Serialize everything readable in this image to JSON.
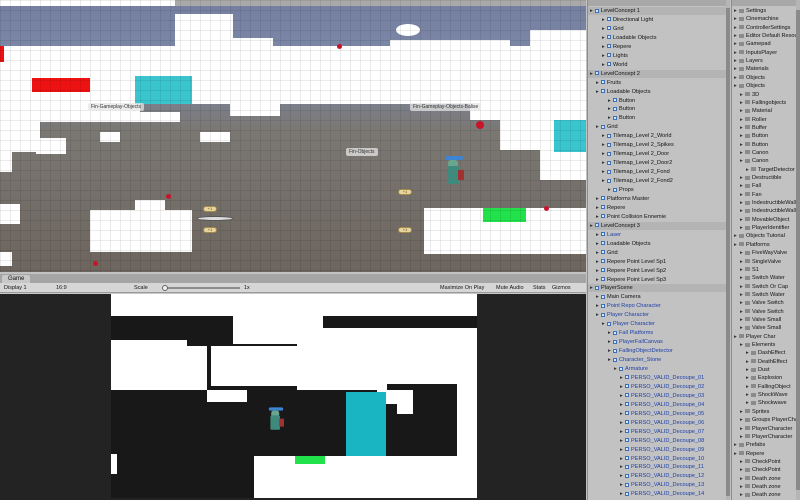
{
  "scene": {
    "labels": {
      "a": "Fin-Gameplay-Objects",
      "b": "Fin-Gameplay-Objects-Balise",
      "c": "Fin-Objects"
    },
    "coins": [
      "+1",
      "+1",
      "+1",
      "+1"
    ]
  },
  "game": {
    "tab": "Game",
    "display": "Display 1",
    "aspect": "16:9",
    "scale_label": "Scale",
    "scale_value": "1x",
    "maximize": "Maximize On Play",
    "mute": "Mute Audio",
    "stats": "Stats",
    "gizmos": "Gizmos"
  },
  "hierarchy": {
    "rows": [
      {
        "t": "LevelConcept 1",
        "i": 0,
        "k": "scene"
      },
      {
        "t": "Directional Light",
        "i": 2
      },
      {
        "t": "Grid",
        "i": 2
      },
      {
        "t": "Loadable Objects",
        "i": 2
      },
      {
        "t": "Repere",
        "i": 2
      },
      {
        "t": "Lights",
        "i": 2
      },
      {
        "t": "World",
        "i": 2
      },
      {
        "t": "LevelConcept 2",
        "i": 0,
        "k": "scene"
      },
      {
        "t": "Fruits",
        "i": 1
      },
      {
        "t": "Loadable Objects",
        "i": 1
      },
      {
        "t": "Button",
        "i": 3
      },
      {
        "t": "Button",
        "i": 3
      },
      {
        "t": "Button",
        "i": 3
      },
      {
        "t": "Grid",
        "i": 1
      },
      {
        "t": "Tilemap_Level 2_World",
        "i": 2
      },
      {
        "t": "Tilemap_Level 2_Spikes",
        "i": 2
      },
      {
        "t": "Tilemap_Level 2_Door",
        "i": 2
      },
      {
        "t": "Tilemap_Level 2_Door2",
        "i": 2
      },
      {
        "t": "Tilemap_Level 2_Fond",
        "i": 2
      },
      {
        "t": "Tilemap_Level 2_Fond2",
        "i": 2
      },
      {
        "t": "Props",
        "i": 3
      },
      {
        "t": "Platforms Master",
        "i": 1
      },
      {
        "t": "Repere",
        "i": 1
      },
      {
        "t": "Point Collision Ennemie",
        "i": 1
      },
      {
        "t": "LevelConcept 3",
        "i": 0,
        "k": "scene"
      },
      {
        "t": "Laser",
        "i": 1,
        "k": "blue"
      },
      {
        "t": "Loadable Objects",
        "i": 1
      },
      {
        "t": "Grid",
        "i": 1
      },
      {
        "t": "Repere Point Level Sp1",
        "i": 1
      },
      {
        "t": "Repere Point Level Sp2",
        "i": 1
      },
      {
        "t": "Repere Point Level Sp3",
        "i": 1
      },
      {
        "t": "PlayerScene",
        "i": 0,
        "k": "scene"
      },
      {
        "t": "Main Camera",
        "i": 1
      },
      {
        "t": "Point Repo Character",
        "i": 1,
        "k": "blue"
      },
      {
        "t": "Player Character",
        "i": 1,
        "k": "blue"
      },
      {
        "t": "Player Character",
        "i": 2,
        "k": "blue"
      },
      {
        "t": "Fall Platforms",
        "i": 3,
        "k": "blue"
      },
      {
        "t": "PlayerFallCanvas",
        "i": 3,
        "k": "blue"
      },
      {
        "t": "FallingObjectDetector",
        "i": 3,
        "k": "blue"
      },
      {
        "t": "Character_Stone",
        "i": 3,
        "k": "blue"
      },
      {
        "t": "Armature",
        "i": 4,
        "k": "blue"
      },
      {
        "t": "PERSO_VALID_Decoupe_01",
        "i": 5,
        "k": "blue"
      },
      {
        "t": "PERSO_VALID_Decoupe_02",
        "i": 5,
        "k": "blue"
      },
      {
        "t": "PERSO_VALID_Decoupe_03",
        "i": 5,
        "k": "blue"
      },
      {
        "t": "PERSO_VALID_Decoupe_04",
        "i": 5,
        "k": "blue"
      },
      {
        "t": "PERSO_VALID_Decoupe_05",
        "i": 5,
        "k": "blue"
      },
      {
        "t": "PERSO_VALID_Decoupe_06",
        "i": 5,
        "k": "blue"
      },
      {
        "t": "PERSO_VALID_Decoupe_07",
        "i": 5,
        "k": "blue"
      },
      {
        "t": "PERSO_VALID_Decoupe_08",
        "i": 5,
        "k": "blue"
      },
      {
        "t": "PERSO_VALID_Decoupe_09",
        "i": 5,
        "k": "blue"
      },
      {
        "t": "PERSO_VALID_Decoupe_10",
        "i": 5,
        "k": "blue"
      },
      {
        "t": "PERSO_VALID_Decoupe_11",
        "i": 5,
        "k": "blue"
      },
      {
        "t": "PERSO_VALID_Decoupe_12",
        "i": 5,
        "k": "blue"
      },
      {
        "t": "PERSO_VALID_Decoupe_13",
        "i": 5,
        "k": "blue"
      },
      {
        "t": "PERSO_VALID_Decoupe_14",
        "i": 5,
        "k": "blue"
      }
    ]
  },
  "project": {
    "rows": [
      {
        "t": "Settings",
        "i": 0
      },
      {
        "t": "Cinemachine",
        "i": 0
      },
      {
        "t": "ControllerSettings",
        "i": 0
      },
      {
        "t": "Editor Default Resources",
        "i": 0
      },
      {
        "t": "Gamepad",
        "i": 0
      },
      {
        "t": "InputsPlayer",
        "i": 0
      },
      {
        "t": "Layers",
        "i": 0
      },
      {
        "t": "Materials",
        "i": 0
      },
      {
        "t": "Objects",
        "i": 0
      },
      {
        "t": "Objects",
        "i": 0
      },
      {
        "t": "3D",
        "i": 1
      },
      {
        "t": "Fallingobjects",
        "i": 1
      },
      {
        "t": "Material",
        "i": 1
      },
      {
        "t": "Roller",
        "i": 1
      },
      {
        "t": "Buffer",
        "i": 1
      },
      {
        "t": "Button",
        "i": 1
      },
      {
        "t": "Button",
        "i": 1
      },
      {
        "t": "Canon",
        "i": 1
      },
      {
        "t": "Canon",
        "i": 1
      },
      {
        "t": "TargetDetector",
        "i": 2
      },
      {
        "t": "Destructible",
        "i": 1
      },
      {
        "t": "Fall",
        "i": 1
      },
      {
        "t": "Fan",
        "i": 1
      },
      {
        "t": "IndestructibleWall",
        "i": 1
      },
      {
        "t": "IndestructibleWall",
        "i": 1
      },
      {
        "t": "MovableObject",
        "i": 1
      },
      {
        "t": "PlayerIdentifier",
        "i": 1
      },
      {
        "t": "Objects Tutorial",
        "i": 0
      },
      {
        "t": "Platforms",
        "i": 0
      },
      {
        "t": "FiveWayValve",
        "i": 1
      },
      {
        "t": "SingleValve",
        "i": 1
      },
      {
        "t": "S1",
        "i": 1
      },
      {
        "t": "Switch Water",
        "i": 1
      },
      {
        "t": "Switch Or Cap",
        "i": 1
      },
      {
        "t": "Switch Water",
        "i": 1
      },
      {
        "t": "Valve Switch",
        "i": 1
      },
      {
        "t": "Valve Switch",
        "i": 1
      },
      {
        "t": "Valve Small",
        "i": 1
      },
      {
        "t": "Valve Small",
        "i": 1
      },
      {
        "t": "Player Char",
        "i": 0
      },
      {
        "t": "Elements",
        "i": 1
      },
      {
        "t": "DashEffect",
        "i": 2
      },
      {
        "t": "DeathEffect",
        "i": 2
      },
      {
        "t": "Dust",
        "i": 2
      },
      {
        "t": "Explosion",
        "i": 2
      },
      {
        "t": "FallingObject",
        "i": 2
      },
      {
        "t": "ShockWave",
        "i": 2
      },
      {
        "t": "Shockwave",
        "i": 2
      },
      {
        "t": "Sprites",
        "i": 1
      },
      {
        "t": "Groups PlayerCharacter",
        "i": 1
      },
      {
        "t": "PlayerCharacter",
        "i": 1
      },
      {
        "t": "PlayerCharacter",
        "i": 1
      },
      {
        "t": "Prefabs",
        "i": 0
      },
      {
        "t": "Repere",
        "i": 0
      },
      {
        "t": "CheckPoint",
        "i": 1
      },
      {
        "t": "CheckPoint",
        "i": 1
      },
      {
        "t": "Death zone",
        "i": 1
      },
      {
        "t": "Death zone",
        "i": 1
      },
      {
        "t": "Death zone",
        "i": 1
      }
    ]
  }
}
